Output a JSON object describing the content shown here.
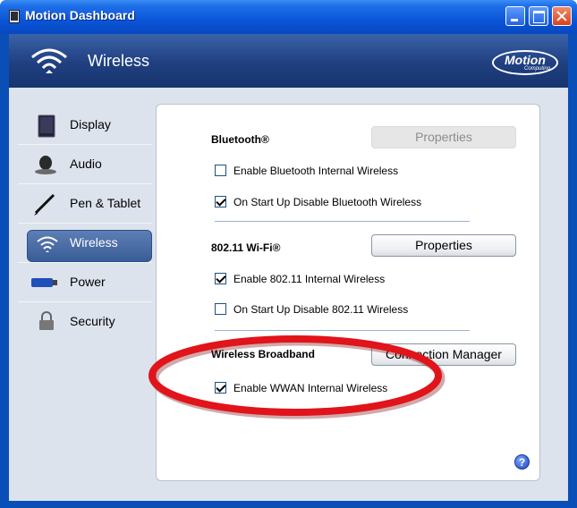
{
  "window": {
    "title": "Motion Dashboard"
  },
  "header": {
    "title": "Wireless",
    "brand": {
      "main": "Motion",
      "sub": "Computing"
    }
  },
  "sidebar": {
    "items": [
      {
        "label": "Display",
        "icon": "display-icon"
      },
      {
        "label": "Audio",
        "icon": "audio-icon"
      },
      {
        "label": "Pen & Tablet",
        "icon": "pen-icon"
      },
      {
        "label": "Wireless",
        "icon": "wifi-icon",
        "active": true
      },
      {
        "label": "Power",
        "icon": "battery-icon"
      },
      {
        "label": "Security",
        "icon": "lock-icon"
      }
    ]
  },
  "bluetooth": {
    "title": "Bluetooth®",
    "properties_label": "Properties",
    "properties_enabled": false,
    "options": [
      {
        "label": "Enable Bluetooth Internal  Wireless",
        "checked": false
      },
      {
        "label": "On Start Up Disable Bluetooth Wireless",
        "checked": true
      }
    ]
  },
  "wifi": {
    "title": "802.11 Wi-Fi®",
    "properties_label": "Properties",
    "properties_enabled": true,
    "options": [
      {
        "label": "Enable 802.11 Internal Wireless",
        "checked": true
      },
      {
        "label": "On Start Up Disable 802.11 Wireless",
        "checked": false
      }
    ]
  },
  "wwan": {
    "title": "Wireless Broadband",
    "button_label": "Connection Manager",
    "options": [
      {
        "label": "Enable WWAN Internal Wireless",
        "checked": true
      }
    ]
  },
  "help": {
    "label": "?"
  },
  "colors": {
    "title_bar": "#0a55d8",
    "header_bg": "#1f3f80",
    "active_nav": "#3a5d97",
    "annotation": "#e0141a"
  }
}
